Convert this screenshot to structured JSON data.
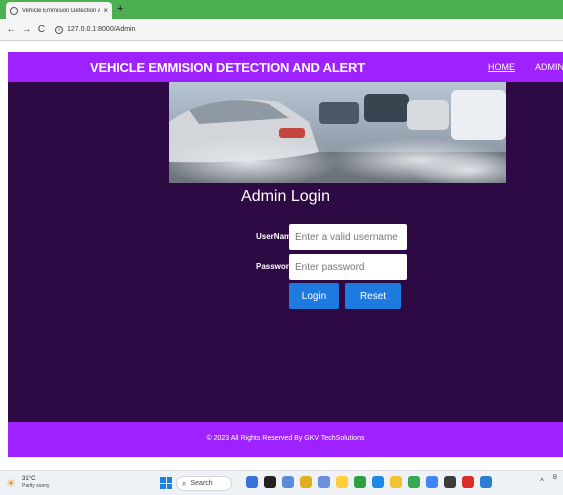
{
  "browser": {
    "tab_title": "Vehicle Emmision Detection And",
    "tab_close": "×",
    "new_tab": "+",
    "back": "←",
    "forward": "→",
    "reload": "C",
    "url": "127.0.0.1:8000/Admin"
  },
  "navbar": {
    "brand": "VEHICLE EMMISION DETECTION AND ALERT",
    "home": "HOME",
    "admin": "ADMIN"
  },
  "login": {
    "title": "Admin Login",
    "username_label": "UserName",
    "username_placeholder": "Enter a valid username",
    "password_label": "Password",
    "password_placeholder": "Enter password",
    "login_button": "Login",
    "reset_button": "Reset"
  },
  "footer": {
    "text": "© 2023 All Rights Reserved By GKV TechSolutions"
  },
  "taskbar": {
    "temperature": "31°C",
    "weather": "Partly sunny",
    "search": "Search",
    "clock": "B"
  },
  "colors": {
    "navbar": "#9e22ff",
    "main_bg": "#2e0a45",
    "button": "#1f7ae0",
    "tab_strip": "#4caf50"
  }
}
